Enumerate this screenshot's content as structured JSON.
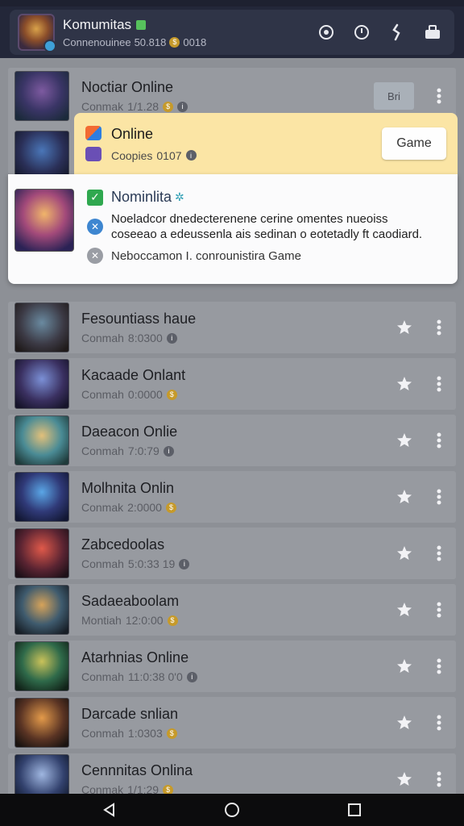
{
  "header": {
    "title": "Komumitas",
    "subtitle": "Connenouinee",
    "subtitle_num": "50.818",
    "subtitle_tail": "0018",
    "icons": [
      "compass-icon",
      "clock-icon",
      "link-icon",
      "inventory-icon"
    ]
  },
  "first_row": {
    "title": "Noctiar Online",
    "meta": "Conmak",
    "meta_num": "1/1.28",
    "button_label": "Bri"
  },
  "popup": {
    "title": "Online",
    "subtitle": "Coopies",
    "subtitle_num": "0107",
    "game_button": "Game",
    "detail_title": "Nominlita",
    "detail_desc": "Noeladcor dnedecterenene cerine omentes nueoiss coseeao a edeussenla ais sedinan o eotetadly ft caodiard.",
    "detail_footer": "Neboccamon I. conrounistira Game"
  },
  "rows": [
    {
      "title": "Fesountiass haue",
      "meta": "Conmah",
      "num": "8:0300"
    },
    {
      "title": "Kacaade Onlant",
      "meta": "Conmah",
      "num": "0:0000"
    },
    {
      "title": "Daeacon Onlie",
      "meta": "Conmah",
      "num": "7:0:79"
    },
    {
      "title": "Molhnita Onlin",
      "meta": "Conmak",
      "num": "2:0000"
    },
    {
      "title": "Zabcedoolas",
      "meta": "Conmah",
      "num": "5:0:33 19"
    },
    {
      "title": "Sadaeaboolam",
      "meta": "Montiah",
      "num": "12:0:00"
    },
    {
      "title": "Atarhnias Online",
      "meta": "Conmah",
      "num": "11:0:38 0'0"
    },
    {
      "title": "Darcade snlian",
      "meta": "Conmah",
      "num": "1:0303"
    },
    {
      "title": "Cennnitas Onlina",
      "meta": "Conmak",
      "num": "1/1:29"
    }
  ],
  "nav": {
    "back": "back-icon",
    "home": "home-icon",
    "recents": "recents-icon"
  }
}
